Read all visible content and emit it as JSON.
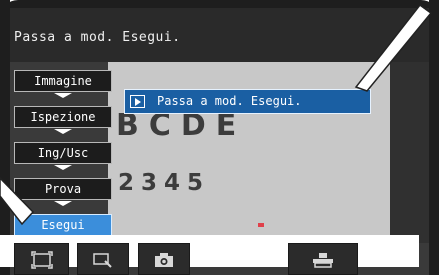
{
  "title_bar": {
    "text": "Passa a mod. Esegui."
  },
  "sample_image": {
    "letters": "BCDE",
    "digits": "2345"
  },
  "menu": {
    "items": [
      {
        "label": "Immagine"
      },
      {
        "label": "Ispezione"
      },
      {
        "label": "Ing/Usc"
      },
      {
        "label": "Prova"
      },
      {
        "label": "Esegui",
        "active": true
      }
    ]
  },
  "popup": {
    "label": "Passa a mod. Esegui.",
    "icon": "play-icon"
  },
  "toolbar": {
    "buttons": [
      {
        "icon": "fit-frame-icon"
      },
      {
        "icon": "zoom-icon"
      },
      {
        "icon": "camera-icon"
      },
      {
        "icon": "save-icon"
      }
    ]
  },
  "colors": {
    "accent": "#3b8edb",
    "popup": "#1a5fa3",
    "background": "#3a3a3a"
  }
}
